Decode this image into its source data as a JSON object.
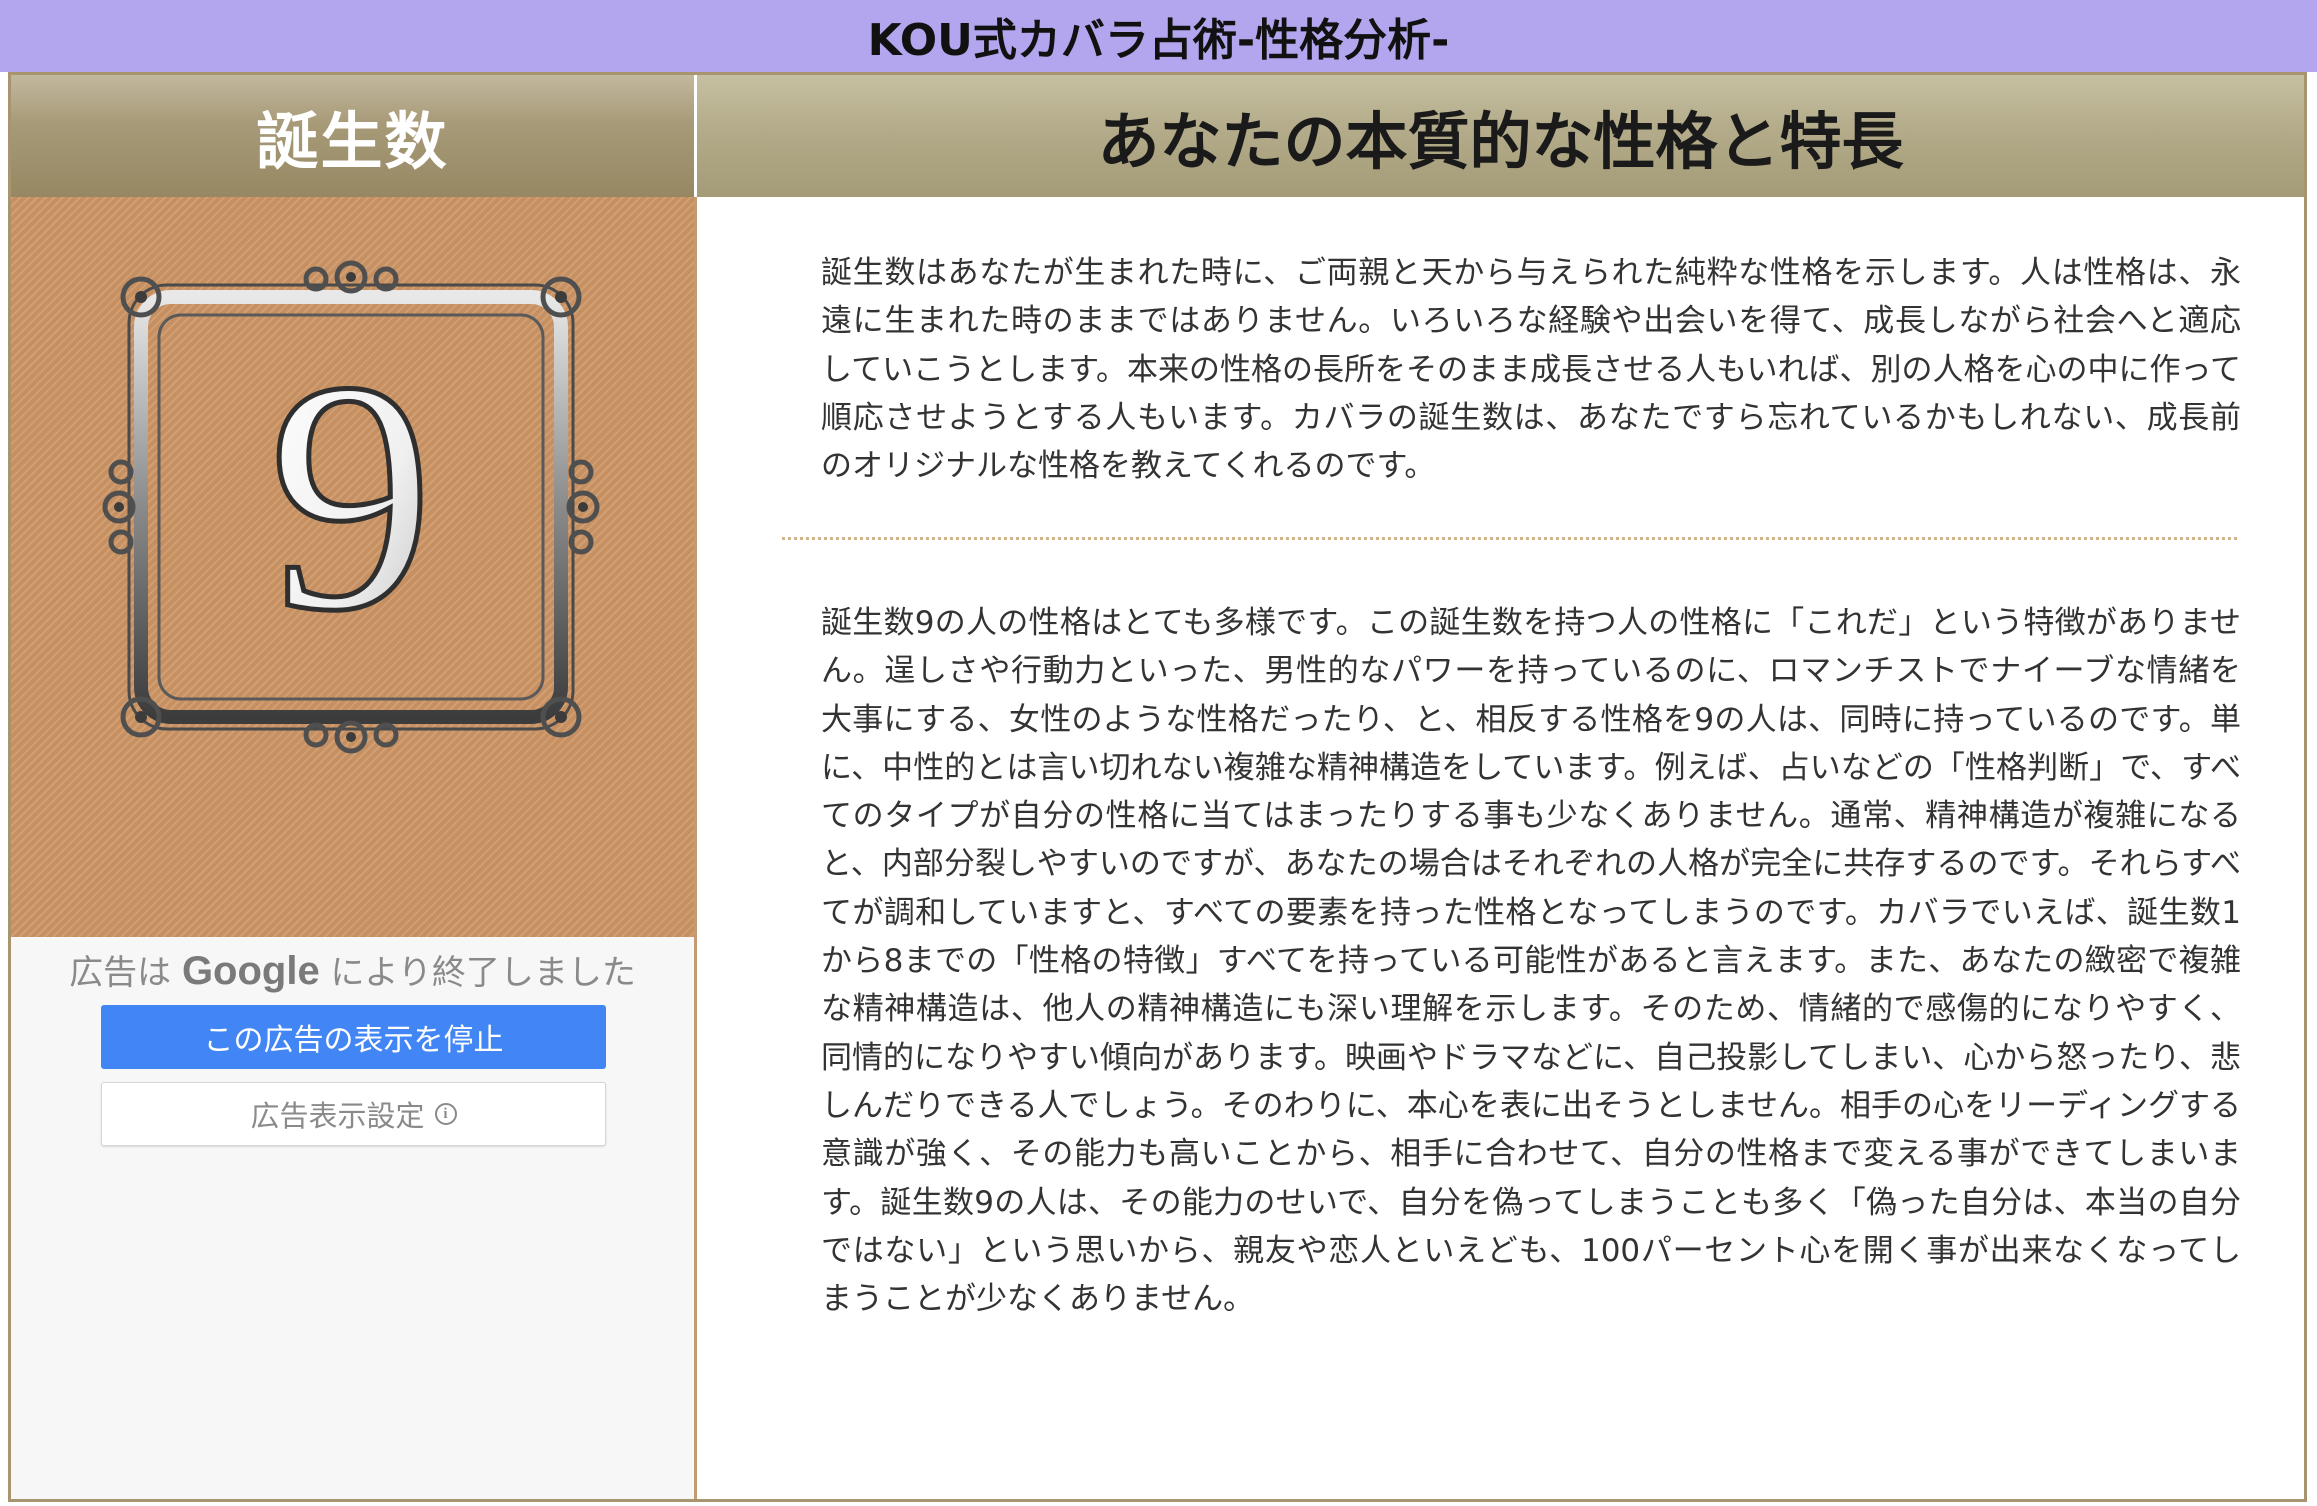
{
  "app_title": "KOU式カバラ占術-性格分析-",
  "header": {
    "left_title": "誕生数",
    "right_title": "あなたの本質的な性格と特長"
  },
  "birth_number": "9",
  "ad": {
    "closed_prefix": "広告は",
    "closed_brand": "Google",
    "closed_suffix": "により終了しました",
    "stop_button": "この広告の表示を停止",
    "settings_button": "広告表示設定",
    "info_glyph": "i"
  },
  "content": {
    "paragraph1": "誕生数はあなたが生まれた時に、ご両親と天から与えられた純粋な性格を示します。人は性格は、永遠に生まれた時のままではありません。いろいろな経験や出会いを得て、成長しながら社会へと適応していこうとします。本来の性格の長所をそのまま成長させる人もいれば、別の人格を心の中に作って順応させようとする人もいます。カバラの誕生数は、あなたですら忘れているかもしれない、成長前のオリジナルな性格を教えてくれるのです。",
    "paragraph2": "誕生数9の人の性格はとても多様です。この誕生数を持つ人の性格に「これだ」という特徴がありません。逞しさや行動力といった、男性的なパワーを持っているのに、ロマンチストでナイーブな情緒を大事にする、女性のような性格だったり、と、相反する性格を9の人は、同時に持っているのです。単に、中性的とは言い切れない複雑な精神構造をしています。例えば、占いなどの「性格判断」で、すべてのタイプが自分の性格に当てはまったりする事も少なくありません。通常、精神構造が複雑になると、内部分裂しやすいのですが、あなたの場合はそれぞれの人格が完全に共存するのです。それらすべてが調和していますと、すべての要素を持った性格となってしまうのです。カバラでいえば、誕生数1から8までの「性格の特徴」すべてを持っている可能性があると言えます。また、あなたの緻密で複雑な精神構造は、他人の精神構造にも深い理解を示します。そのため、情緒的で感傷的になりやすく、同情的になりやすい傾向があります。映画やドラマなどに、自己投影してしまい、心から怒ったり、悲しんだりできる人でしょう。そのわりに、本心を表に出そうとしません。相手の心をリーディングする意識が強く、その能力も高いことから、相手に合わせて、自分の性格まで変える事ができてしまいます。誕生数9の人は、その能力のせいで、自分を偽ってしまうことも多く「偽った自分は、本当の自分ではない」という思いから、親友や恋人といえども、100パーセント心を開く事が出来なくなってしまうことが少なくありません。"
  },
  "colors": {
    "top_bar": "#b3a6ee",
    "number_panel": "#cc9464",
    "frame_border": "#a8946e",
    "ad_button": "#4285f4"
  },
  "icons": {
    "ornate_frame": "ornate-frame-icon",
    "info": "info-icon"
  }
}
